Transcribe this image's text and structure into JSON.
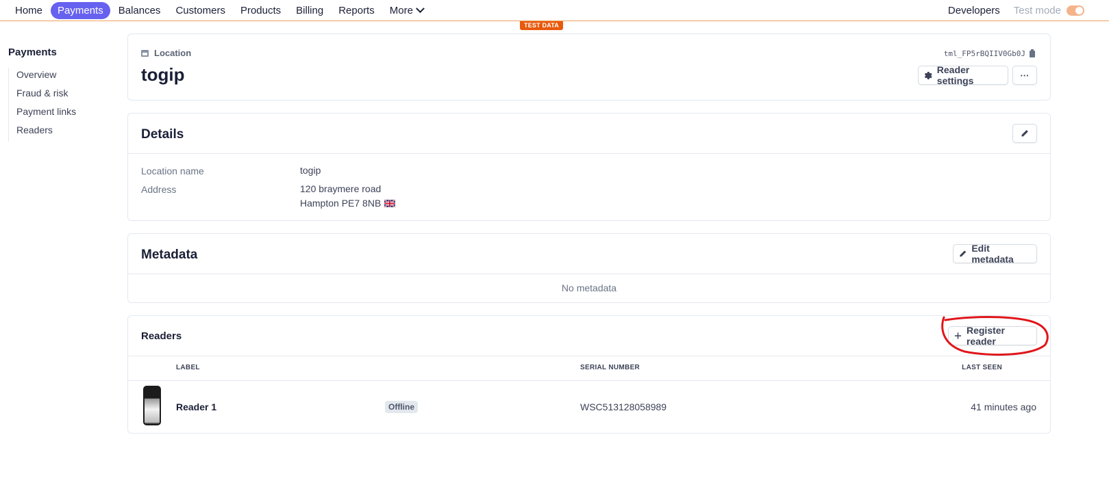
{
  "nav": {
    "items": [
      {
        "label": "Home",
        "active": false
      },
      {
        "label": "Payments",
        "active": true
      },
      {
        "label": "Balances",
        "active": false
      },
      {
        "label": "Customers",
        "active": false
      },
      {
        "label": "Products",
        "active": false
      },
      {
        "label": "Billing",
        "active": false
      },
      {
        "label": "Reports",
        "active": false
      },
      {
        "label": "More",
        "active": false
      }
    ],
    "developers": "Developers",
    "test_mode": "Test mode",
    "accent_color": "#6761f0"
  },
  "test_badge": "TEST DATA",
  "sidebar": {
    "title": "Payments",
    "items": [
      {
        "label": "Overview"
      },
      {
        "label": "Fraud & risk"
      },
      {
        "label": "Payment links"
      },
      {
        "label": "Readers"
      }
    ]
  },
  "location": {
    "kind_label": "Location",
    "name": "togip",
    "id": "tml_FP5rBQIIV0Gb0J",
    "reader_settings_label": "Reader settings",
    "more_label": "···"
  },
  "details": {
    "title": "Details",
    "name_label": "Location name",
    "name_value": "togip",
    "address_label": "Address",
    "address_line1": "120 braymere road",
    "address_line2": "Hampton PE7 8NB"
  },
  "metadata": {
    "title": "Metadata",
    "edit_label": "Edit metadata",
    "empty": "No metadata"
  },
  "readers": {
    "title": "Readers",
    "register_label": "Register reader",
    "columns": {
      "label": "LABEL",
      "serial": "SERIAL NUMBER",
      "last_seen": "LAST SEEN"
    },
    "rows": [
      {
        "label": "Reader 1",
        "status": "Offline",
        "serial": "WSC513128058989",
        "last_seen": "41 minutes ago"
      }
    ]
  }
}
